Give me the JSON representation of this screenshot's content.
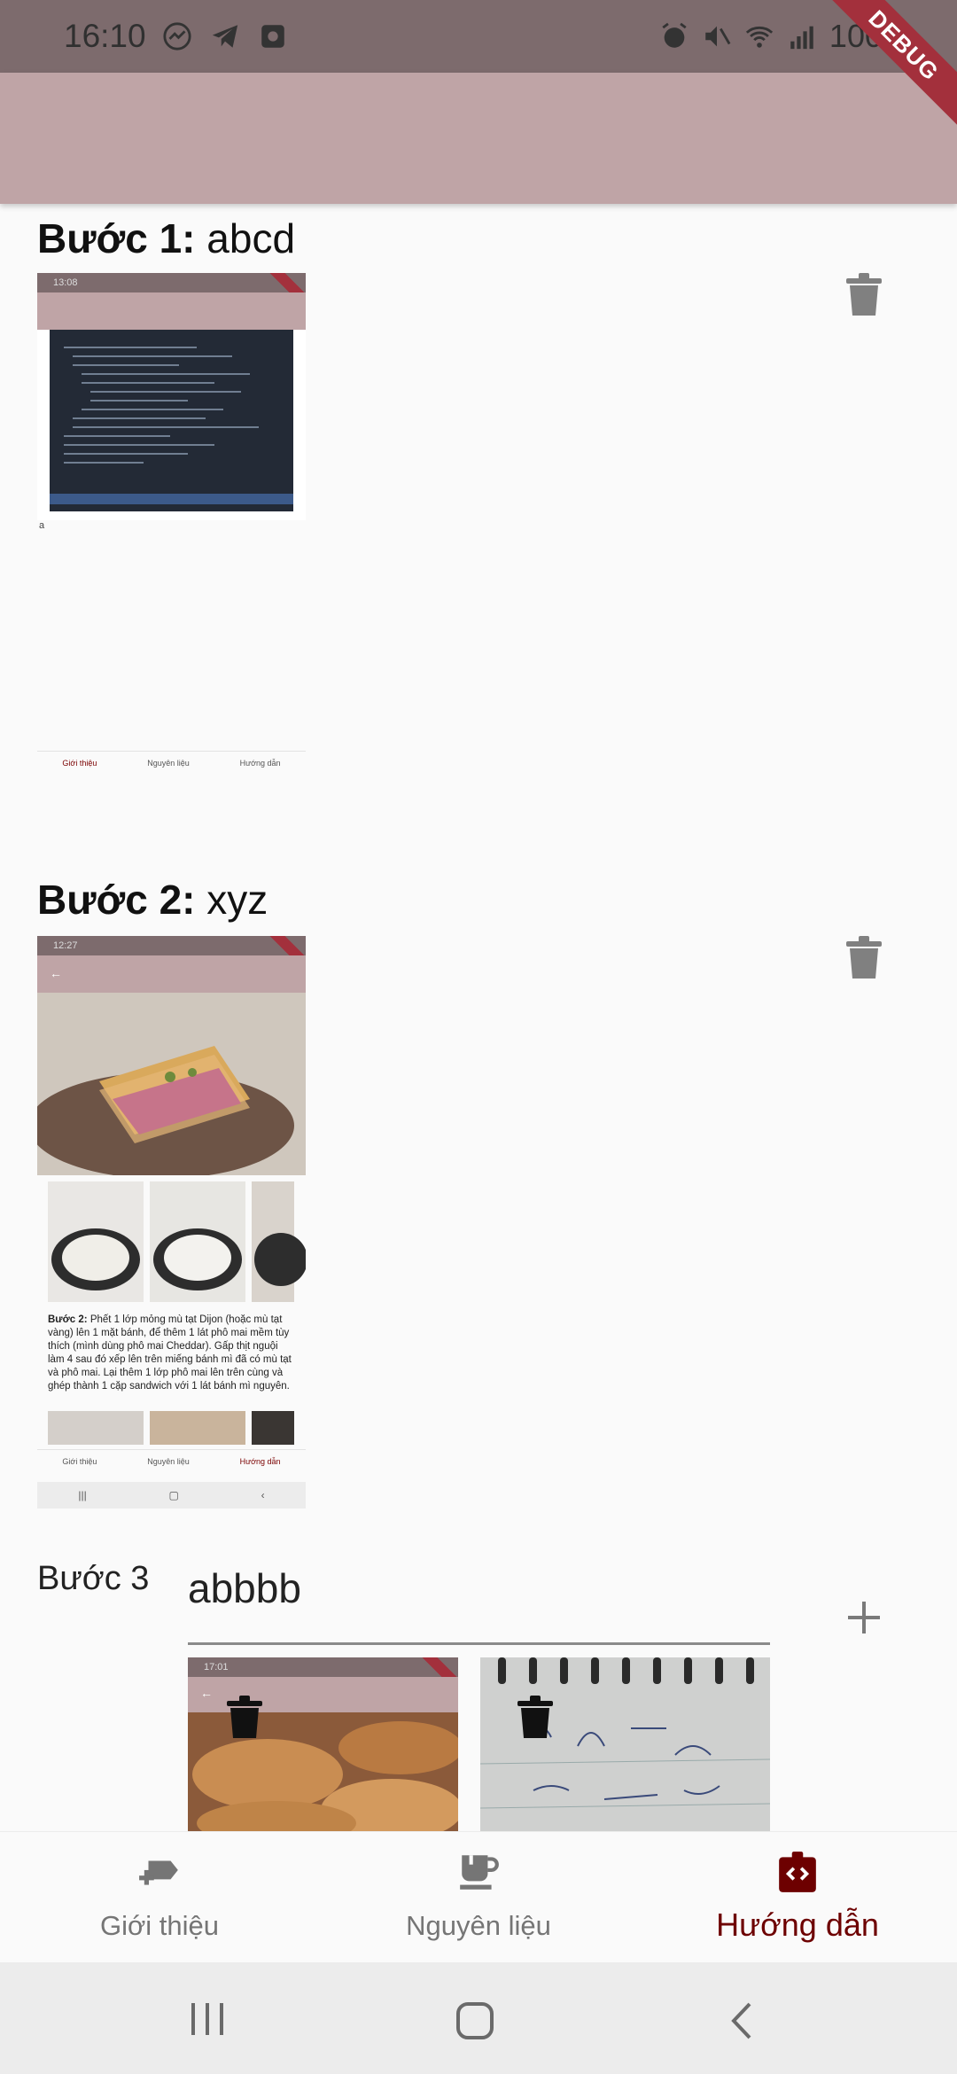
{
  "status_bar": {
    "time": "16:10",
    "battery": "100%",
    "left_icons": [
      "messenger-icon",
      "telegram-icon",
      "screen-record-icon"
    ],
    "right_icons": [
      "alarm-icon",
      "mute-icon",
      "wifi-icon",
      "signal-icon",
      "battery-icon"
    ]
  },
  "debug_banner": "DEBUG",
  "steps": [
    {
      "label": "Bước 1:",
      "text": "abcd",
      "thumbnail": {
        "status_time": "13:08",
        "caption": "a",
        "nav": [
          "Giới thiệu",
          "Nguyên liệu",
          "Hướng dẫn"
        ]
      }
    },
    {
      "label": "Bước 2:",
      "text": "xyz",
      "thumbnail": {
        "status_time": "12:27",
        "step_bold": "Bước 2:",
        "step_text": "Phết 1 lớp mỏng mù tạt Dijon (hoặc mù tạt vàng) lên 1 mặt bánh, để thêm 1 lát phô mai mềm tùy thích (mình dùng phô mai Cheddar). Gấp thịt nguội làm 4 sau đó xếp lên trên miếng bánh mì đã có mù tạt và phô mai. Lại thêm 1 lớp phô mai lên trên cùng và ghép thành 1 cặp sandwich với 1 lát bánh mì nguyên.",
        "nav": [
          "Giới thiệu",
          "Nguyên liệu",
          "Hướng dẫn"
        ]
      }
    }
  ],
  "step3": {
    "label": "Bước 3",
    "input_value": "abbbb",
    "thumb_time": "17:01"
  },
  "bottom_nav": {
    "items": [
      {
        "label": "Giới thiệu",
        "icon": "intro-icon"
      },
      {
        "label": "Nguyên liệu",
        "icon": "coffee-cup-icon"
      },
      {
        "label": "Hướng dẫn",
        "icon": "guide-icon"
      }
    ],
    "active_index": 2,
    "active_color": "#6d0000"
  },
  "colors": {
    "appbar": "#bfa4a6",
    "status_bar": "#7d6b6d",
    "debug": "#a3303c"
  }
}
